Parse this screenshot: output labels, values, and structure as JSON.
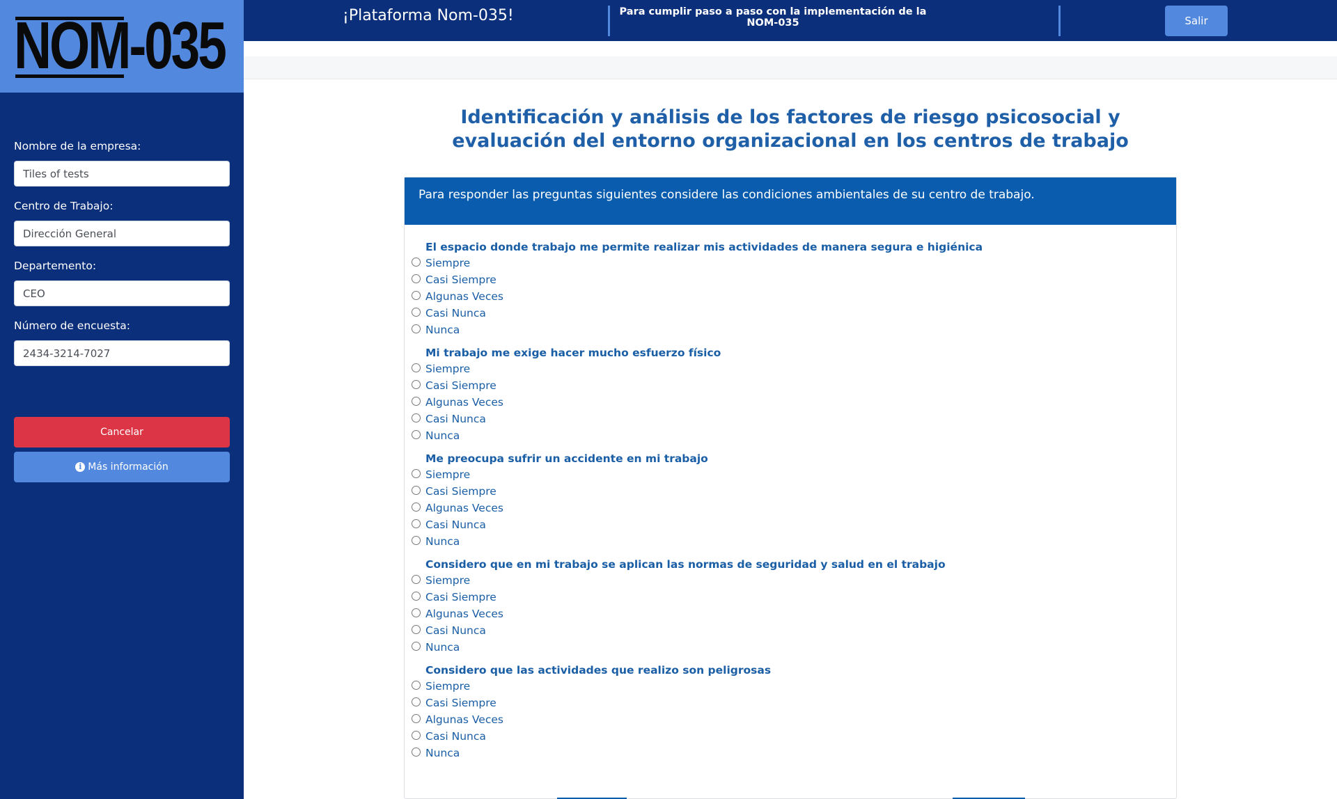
{
  "sidebar": {
    "logo_text": "NOM-035",
    "fields": [
      {
        "label": "Nombre de la empresa:",
        "value": "Tiles of tests"
      },
      {
        "label": "Centro de Trabajo:",
        "value": "Dirección General"
      },
      {
        "label": "Departemento:",
        "value": "CEO"
      },
      {
        "label": "Número de encuesta:",
        "value": "2434-3214-7027"
      }
    ],
    "cancel_label": "Cancelar",
    "info_label": "Más información",
    "info_icon": "info-circle-icon"
  },
  "header": {
    "title": "¡Plataforma Nom-035!",
    "subtitle": "Para cumplir paso a paso con la implementación de la NOM-035",
    "logout_label": "Salir"
  },
  "main": {
    "title": "Identificación y análisis de los factores de riesgo psicosocial y evaluación del entorno organizacional en los centros de trabajo",
    "card_header": "Para responder las preguntas siguientes considere las condiciones ambientales de su centro de trabajo.",
    "options": [
      "Siempre",
      "Casi Siempre",
      "Algunas Veces",
      "Casi Nunca",
      "Nunca"
    ],
    "questions": [
      "El espacio donde trabajo me permite realizar mis actividades de manera segura e higiénica",
      "Mi trabajo me exige hacer mucho esfuerzo físico",
      "Me preocupa sufrir un accidente en mi trabajo",
      "Considero que en mi trabajo se aplican las normas de seguridad y salud en el trabajo",
      "Considero que las actividades que realizo son peligrosas"
    ]
  },
  "colors": {
    "navy": "#0b2f7a",
    "accent_blue": "#5289df",
    "card_header_blue": "#0a5dae",
    "text_blue": "#1a5ea6",
    "danger": "#dc3545"
  }
}
